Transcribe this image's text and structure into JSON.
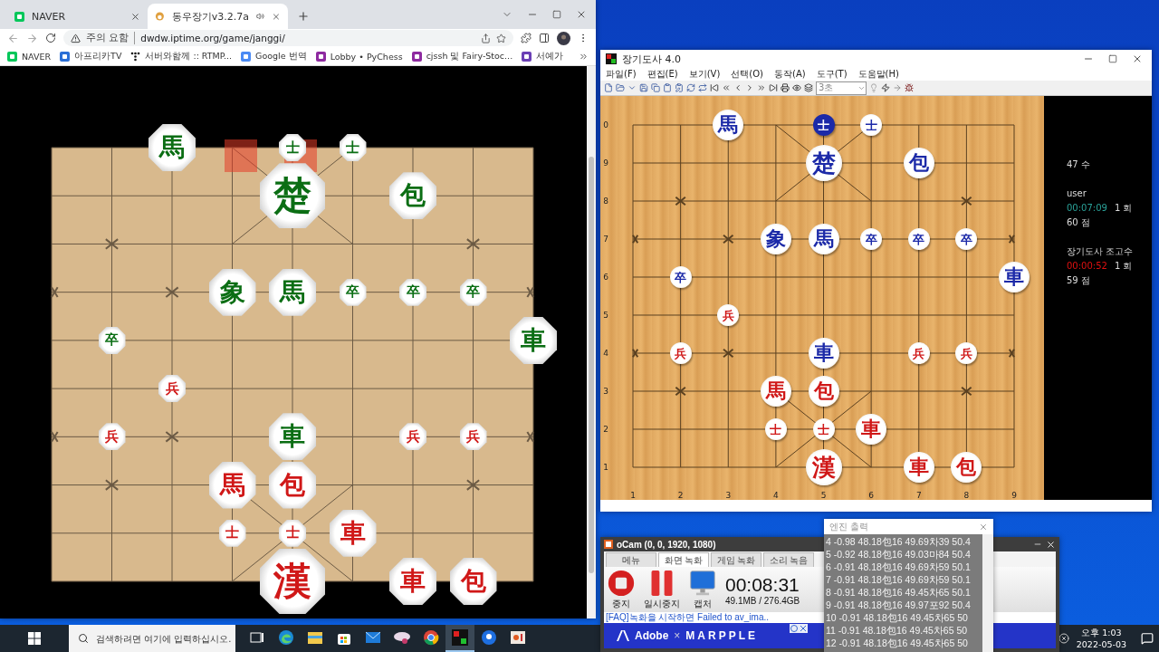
{
  "browser": {
    "tabs": [
      {
        "title": "NAVER",
        "kind": "naver",
        "selected": false,
        "audio": false
      },
      {
        "title": "동우장기v3.2.7a",
        "kind": "game",
        "selected": true,
        "audio": true
      }
    ],
    "security": "주의 요함",
    "url": "dwdw.iptime.org/game/janggi/",
    "bookmarks": [
      {
        "label": "NAVER",
        "kind": "naver"
      },
      {
        "label": "아프리카TV",
        "kind": "tv"
      },
      {
        "label": "서버와함께 :: RTMP...",
        "kind": "dots"
      },
      {
        "label": "Google 번역",
        "kind": "translate"
      },
      {
        "label": "Lobby • PyChess",
        "kind": "chess"
      },
      {
        "label": "cjssh 및 Fairy-Stoc...",
        "kind": "chess"
      },
      {
        "label": "서예가",
        "kind": "brand"
      }
    ],
    "board": {
      "rows": [
        [
          null,
          null,
          {
            "char": "馬",
            "color": "#0b6e14",
            "kind": "major",
            "highlighted": false
          },
          {
            "highlighted": true
          },
          {
            "char": "士",
            "color": "#0b6e14",
            "kind": "minor",
            "highlighted": true
          },
          {
            "char": "士",
            "color": "#0b6e14",
            "kind": "minor",
            "highlighted": false
          },
          null,
          null,
          null
        ],
        [
          null,
          null,
          null,
          null,
          {
            "char": "楚",
            "color": "#0b6e14",
            "kind": "king",
            "highlighted": false
          },
          null,
          {
            "char": "包",
            "color": "#0b6e14",
            "kind": "major",
            "highlighted": false
          },
          null,
          null
        ],
        [
          null,
          null,
          null,
          null,
          null,
          null,
          null,
          null,
          null
        ],
        [
          null,
          null,
          null,
          {
            "char": "象",
            "color": "#0b6e14",
            "kind": "major",
            "highlighted": false
          },
          {
            "char": "馬",
            "color": "#0b6e14",
            "kind": "major",
            "highlighted": false
          },
          {
            "char": "卒",
            "color": "#0b6e14",
            "kind": "minor",
            "highlighted": false
          },
          {
            "char": "卒",
            "color": "#0b6e14",
            "kind": "minor",
            "highlighted": false
          },
          {
            "char": "卒",
            "color": "#0b6e14",
            "kind": "minor",
            "highlighted": false
          },
          null
        ],
        [
          null,
          {
            "char": "卒",
            "color": "#0b6e14",
            "kind": "minor",
            "highlighted": false
          },
          null,
          null,
          null,
          null,
          null,
          null,
          {
            "char": "車",
            "color": "#0b6e14",
            "kind": "major",
            "highlighted": false
          }
        ],
        [
          null,
          null,
          {
            "char": "兵",
            "color": "#d01818",
            "kind": "minor",
            "highlighted": false
          },
          null,
          null,
          null,
          null,
          null,
          null
        ],
        [
          null,
          {
            "char": "兵",
            "color": "#d01818",
            "kind": "minor",
            "highlighted": false
          },
          null,
          null,
          {
            "char": "車",
            "color": "#0b6e14",
            "kind": "major",
            "highlighted": false
          },
          null,
          {
            "char": "兵",
            "color": "#d01818",
            "kind": "minor",
            "highlighted": false
          },
          {
            "char": "兵",
            "color": "#d01818",
            "kind": "minor",
            "highlighted": false
          },
          null
        ],
        [
          null,
          null,
          null,
          {
            "char": "馬",
            "color": "#d01818",
            "kind": "major",
            "highlighted": false
          },
          {
            "char": "包",
            "color": "#d01818",
            "kind": "major",
            "highlighted": false
          },
          null,
          null,
          null,
          null
        ],
        [
          null,
          null,
          null,
          {
            "char": "士",
            "color": "#d01818",
            "kind": "minor",
            "highlighted": false
          },
          {
            "char": "士",
            "color": "#d01818",
            "kind": "minor",
            "highlighted": false
          },
          {
            "char": "車",
            "color": "#d01818",
            "kind": "major",
            "highlighted": false
          },
          null,
          null,
          null
        ],
        [
          null,
          null,
          null,
          null,
          {
            "char": "漢",
            "color": "#d01818",
            "kind": "king",
            "highlighted": false
          },
          null,
          {
            "char": "車",
            "color": "#d01818",
            "kind": "major",
            "highlighted": false
          },
          {
            "char": "包",
            "color": "#d01818",
            "kind": "major",
            "highlighted": false
          },
          null
        ]
      ]
    }
  },
  "app": {
    "title": "장기도사 4.0",
    "menus": [
      "파일(F)",
      "편집(E)",
      "보기(V)",
      "선택(O)",
      "동작(A)",
      "도구(T)",
      "도움말(H)"
    ],
    "time_select": "3초",
    "rank_labels": [
      "0",
      "9",
      "8",
      "7",
      "6",
      "5",
      "4",
      "3",
      "2",
      "1"
    ],
    "file_labels": [
      "1",
      "2",
      "3",
      "4",
      "5",
      "6",
      "7",
      "8",
      "9"
    ],
    "rows": [
      [
        null,
        null,
        {
          "char": "馬",
          "color": "#1c2aa8",
          "kind": "major",
          "selected": false
        },
        null,
        {
          "char": "士",
          "color": "#1c2aa8",
          "kind": "minor",
          "selected": true
        },
        {
          "char": "士",
          "color": "#1c2aa8",
          "kind": "minor",
          "selected": false
        },
        null,
        null,
        null
      ],
      [
        null,
        null,
        null,
        null,
        {
          "char": "楚",
          "color": "#1c2aa8",
          "kind": "king",
          "selected": false
        },
        null,
        {
          "char": "包",
          "color": "#1c2aa8",
          "kind": "major",
          "selected": false
        },
        null,
        null
      ],
      [
        null,
        null,
        null,
        null,
        null,
        null,
        null,
        null,
        null
      ],
      [
        null,
        null,
        null,
        {
          "char": "象",
          "color": "#1c2aa8",
          "kind": "major",
          "selected": false
        },
        {
          "char": "馬",
          "color": "#1c2aa8",
          "kind": "major",
          "selected": false
        },
        {
          "char": "卒",
          "color": "#1c2aa8",
          "kind": "minor",
          "selected": false
        },
        {
          "char": "卒",
          "color": "#1c2aa8",
          "kind": "minor",
          "selected": false
        },
        {
          "char": "卒",
          "color": "#1c2aa8",
          "kind": "minor",
          "selected": false
        },
        null
      ],
      [
        null,
        {
          "char": "卒",
          "color": "#1c2aa8",
          "kind": "minor",
          "selected": false
        },
        null,
        null,
        null,
        null,
        null,
        null,
        {
          "char": "車",
          "color": "#1c2aa8",
          "kind": "major",
          "selected": false
        }
      ],
      [
        null,
        null,
        {
          "char": "兵",
          "color": "#d01818",
          "kind": "minor",
          "selected": false
        },
        null,
        null,
        null,
        null,
        null,
        null
      ],
      [
        null,
        {
          "char": "兵",
          "color": "#d01818",
          "kind": "minor",
          "selected": false
        },
        null,
        null,
        {
          "char": "車",
          "color": "#1c2aa8",
          "kind": "major",
          "selected": false
        },
        null,
        {
          "char": "兵",
          "color": "#d01818",
          "kind": "minor",
          "selected": false
        },
        {
          "char": "兵",
          "color": "#d01818",
          "kind": "minor",
          "selected": false
        },
        null
      ],
      [
        null,
        null,
        null,
        {
          "char": "馬",
          "color": "#d01818",
          "kind": "major",
          "selected": false
        },
        {
          "char": "包",
          "color": "#d01818",
          "kind": "major",
          "selected": false
        },
        null,
        null,
        null,
        null
      ],
      [
        null,
        null,
        null,
        {
          "char": "士",
          "color": "#d01818",
          "kind": "minor",
          "selected": false
        },
        {
          "char": "士",
          "color": "#d01818",
          "kind": "minor",
          "selected": false
        },
        {
          "char": "車",
          "color": "#d01818",
          "kind": "major",
          "selected": false
        },
        null,
        null,
        null
      ],
      [
        null,
        null,
        null,
        null,
        {
          "char": "漢",
          "color": "#d01818",
          "kind": "king",
          "selected": false
        },
        null,
        {
          "char": "車",
          "color": "#d01818",
          "kind": "major",
          "selected": false
        },
        {
          "char": "包",
          "color": "#d01818",
          "kind": "major",
          "selected": false
        },
        null
      ]
    ],
    "move_count": "47 수",
    "players": [
      {
        "name": "user",
        "clock": "00:07:09",
        "color": "#2aa198",
        "rounds": "1 회",
        "score": "60 점"
      },
      {
        "name": "장기도사 조고수",
        "clock": "00:00:52",
        "color": "#e01010",
        "rounds": "1 회",
        "score": "59 점"
      }
    ]
  },
  "ocam": {
    "title": "oCam (0, 0, 1920, 1080)",
    "tabs": [
      {
        "label": "메뉴",
        "selected": false
      },
      {
        "label": "화면 녹화",
        "selected": true
      },
      {
        "label": "게임 녹화",
        "selected": false
      },
      {
        "label": "소리 녹음",
        "selected": false
      }
    ],
    "buttons": [
      {
        "label": "중지",
        "kind": "stop"
      },
      {
        "label": "일시중지",
        "kind": "pause"
      },
      {
        "label": "캡처",
        "kind": "capture"
      }
    ],
    "timer": "00:08:31",
    "storage": "49.1MB / 276.4GB",
    "faq": "[FAQ]녹화을 시작하면 Failed to av_ima..",
    "ad": {
      "brand": "Adobe",
      "separator": "×",
      "partner": "MARPPLE"
    }
  },
  "engine": {
    "title": "엔진 출력",
    "lines": [
      "4 -0.98 48.18包16 49.69차39 50.4",
      "5 -0.92 48.18包16 49.03마84 50.4",
      "6 -0.91 48.18包16 49.69차59 50.1",
      "7 -0.91 48.18包16 49.69차59 50.1",
      "8 -0.91 48.18包16 49.45차65 50.1",
      "9 -0.91 48.18包16 49.97포92 50.4",
      "10 -0.91 48.18包16 49.45차65 50",
      "11 -0.91 48.18包16 49.45차65 50",
      "12 -0.91 48.18包16 49.45차65 50"
    ]
  },
  "taskbar": {
    "search_placeholder": "검색하려면 여기에 입력하십시오.",
    "apps": [
      {
        "kind": "taskview",
        "active": false
      },
      {
        "kind": "edge",
        "active": false
      },
      {
        "kind": "folder",
        "active": false
      },
      {
        "kind": "store",
        "active": false
      },
      {
        "kind": "mail",
        "active": false
      },
      {
        "kind": "disc",
        "active": false
      },
      {
        "kind": "chrome",
        "active": false
      },
      {
        "kind": "janggi",
        "active": true
      },
      {
        "kind": "blue",
        "active": false
      },
      {
        "kind": "ocam",
        "active": false
      }
    ],
    "time": "오후 1:03",
    "date": "2022-05-03"
  }
}
